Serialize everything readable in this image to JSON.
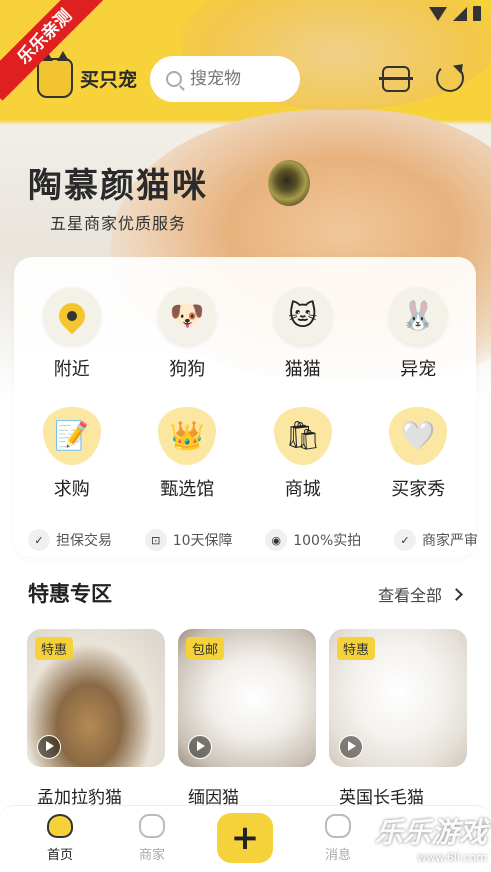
{
  "ribbon": {
    "label": "乐乐亲测"
  },
  "header": {
    "app_name": "买只宠",
    "search_placeholder": "搜宠物"
  },
  "banner": {
    "title": "陶慕颜猫咪",
    "subtitle": "五星商家优质服务"
  },
  "categories": [
    {
      "label": "附近",
      "icon": "location-pin-icon"
    },
    {
      "label": "狗狗",
      "icon": "dog-face-icon"
    },
    {
      "label": "猫猫",
      "icon": "cat-face-icon"
    },
    {
      "label": "异宠",
      "icon": "exotic-pet-icon"
    },
    {
      "label": "求购",
      "icon": "request-icon"
    },
    {
      "label": "甄选馆",
      "icon": "crown-icon"
    },
    {
      "label": "商城",
      "icon": "shopping-bag-icon"
    },
    {
      "label": "买家秀",
      "icon": "heart-icon"
    }
  ],
  "guarantees": [
    {
      "label": "担保交易",
      "icon": "shield-check-icon"
    },
    {
      "label": "10天保障",
      "icon": "calendar-10-icon"
    },
    {
      "label": "100%实拍",
      "icon": "camera-icon"
    },
    {
      "label": "商家严审",
      "icon": "user-check-icon"
    }
  ],
  "specials": {
    "title": "特惠专区",
    "view_all": "查看全部",
    "items": [
      {
        "tag": "特惠",
        "name": "孟加拉豹猫"
      },
      {
        "tag": "包邮",
        "name": "缅因猫"
      },
      {
        "tag": "特惠",
        "name": "英国长毛猫"
      }
    ]
  },
  "nav": {
    "home": "首页",
    "merchants": "商家",
    "messages": "消息",
    "publish": "+"
  },
  "watermark": {
    "title": "乐乐游戏",
    "url": "www.6ll.com"
  },
  "colors": {
    "accent": "#f6d23a",
    "ribbon": "#e02020"
  }
}
